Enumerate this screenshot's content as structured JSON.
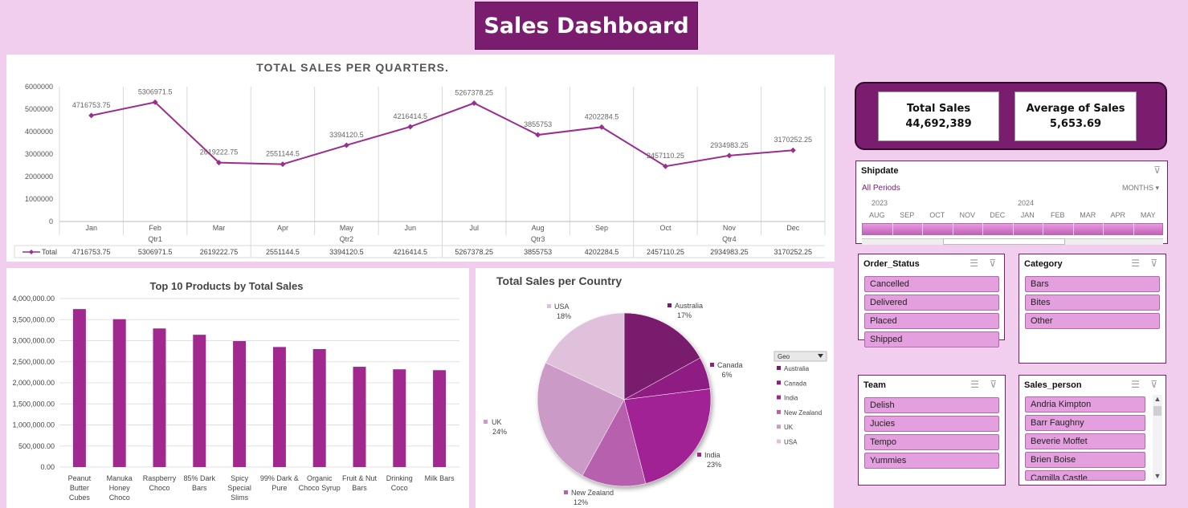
{
  "dashboard_title": "Sales Dashboard",
  "colors": {
    "accent": "#7b1d6f",
    "line": "#9b2d8f",
    "bar": "#a0288f",
    "slicer_item": "#e49fdf",
    "background": "#f1cdee"
  },
  "kpi": {
    "total_sales_label": "Total Sales",
    "total_sales_value": "44,692,389",
    "average_label": "Average of Sales",
    "average_value": "5,653.69"
  },
  "slicers": {
    "shipdate": {
      "title": "Shipdate",
      "all_periods": "All Periods",
      "level": "MONTHS",
      "years": [
        "2023",
        "2024"
      ],
      "months": [
        "AUG",
        "SEP",
        "OCT",
        "NOV",
        "DEC",
        "JAN",
        "FEB",
        "MAR",
        "APR",
        "MAY"
      ]
    },
    "order_status": {
      "title": "Order_Status",
      "items": [
        "Cancelled",
        "Delivered",
        "Placed",
        "Shipped"
      ]
    },
    "category": {
      "title": "Category",
      "items": [
        "Bars",
        "Bites",
        "Other"
      ]
    },
    "team": {
      "title": "Team",
      "items": [
        "Delish",
        "Jucies",
        "Tempo",
        "Yummies"
      ]
    },
    "sales_person": {
      "title": "Sales_person",
      "items": [
        "Andria Kimpton",
        "Barr Faughny",
        "Beverie Moffet",
        "Brien Boise",
        "Camilla Castle"
      ]
    }
  },
  "chart_data": [
    {
      "type": "line",
      "title": "TOTAL SALES PER QUARTERS.",
      "categories": [
        "Jan",
        "Feb",
        "Mar",
        "Apr",
        "May",
        "Jun",
        "Jul",
        "Aug",
        "Sep",
        "Oct",
        "Nov",
        "Dec"
      ],
      "quarters": [
        "Qtr1",
        "Qtr2",
        "Qtr3",
        "Qtr4"
      ],
      "series": [
        {
          "name": "Total",
          "values": [
            4716753.75,
            5306971.5,
            2619222.75,
            2551144.5,
            3394120.5,
            4216414.5,
            5267378.25,
            3855753,
            4202284.5,
            2457110.25,
            2934983.25,
            3170252.25
          ]
        }
      ],
      "value_labels": [
        "4716753.75",
        "5306971.5",
        "2619222.75",
        "2551144.5",
        "3394120.5",
        "4216414.5",
        "5267378.25",
        "3855753",
        "4202284.5",
        "2457110.25",
        "2934983.25",
        "3170252.25"
      ],
      "ylim": [
        0,
        6000000
      ],
      "yticks": [
        "6000000",
        "5000000",
        "4000000",
        "3000000",
        "2000000",
        "1000000",
        "0"
      ],
      "grid": "vertical",
      "legend": "data-table"
    },
    {
      "type": "bar",
      "title": "Top 10 Products by Total Sales",
      "categories": [
        [
          "Peanut",
          "Butter",
          "Cubes"
        ],
        [
          "Manuka",
          "Honey",
          "Choco"
        ],
        [
          "Raspberry",
          "Choco"
        ],
        [
          "85% Dark",
          "Bars"
        ],
        [
          "Spicy",
          "Special",
          "Slims"
        ],
        [
          "99% Dark &",
          "Pure"
        ],
        [
          "Organic",
          "Choco Syrup"
        ],
        [
          "Fruit & Nut",
          "Bars"
        ],
        [
          "Drinking",
          "Coco"
        ],
        [
          "Milk Bars"
        ]
      ],
      "values": [
        3750000,
        3510000,
        3290000,
        3140000,
        2990000,
        2850000,
        2800000,
        2380000,
        2320000,
        2300000
      ],
      "ylim": [
        0,
        4000000
      ],
      "yticks": [
        "4,000,000.00",
        "3,500,000.00",
        "3,000,000.00",
        "2,500,000.00",
        "2,000,000.00",
        "1,500,000.00",
        "1,000,000.00",
        "500,000.00",
        "0.00"
      ],
      "grid": true
    },
    {
      "type": "pie",
      "title": "Total Sales per Country",
      "legend_title": "Geo",
      "slices": [
        {
          "label": "Australia",
          "pct": 17,
          "pct_label": "17%",
          "color": "#7a1a6e"
        },
        {
          "label": "Canada",
          "pct": 6,
          "pct_label": "6%",
          "color": "#8e1f82"
        },
        {
          "label": "India",
          "pct": 23,
          "pct_label": "23%",
          "color": "#a02394"
        },
        {
          "label": "New Zealand",
          "pct": 12,
          "pct_label": "12%",
          "color": "#b760ad"
        },
        {
          "label": "UK",
          "pct": 24,
          "pct_label": "24%",
          "color": "#cc9ac6"
        },
        {
          "label": "USA",
          "pct": 18,
          "pct_label": "18%",
          "color": "#dfc1db"
        }
      ]
    }
  ]
}
